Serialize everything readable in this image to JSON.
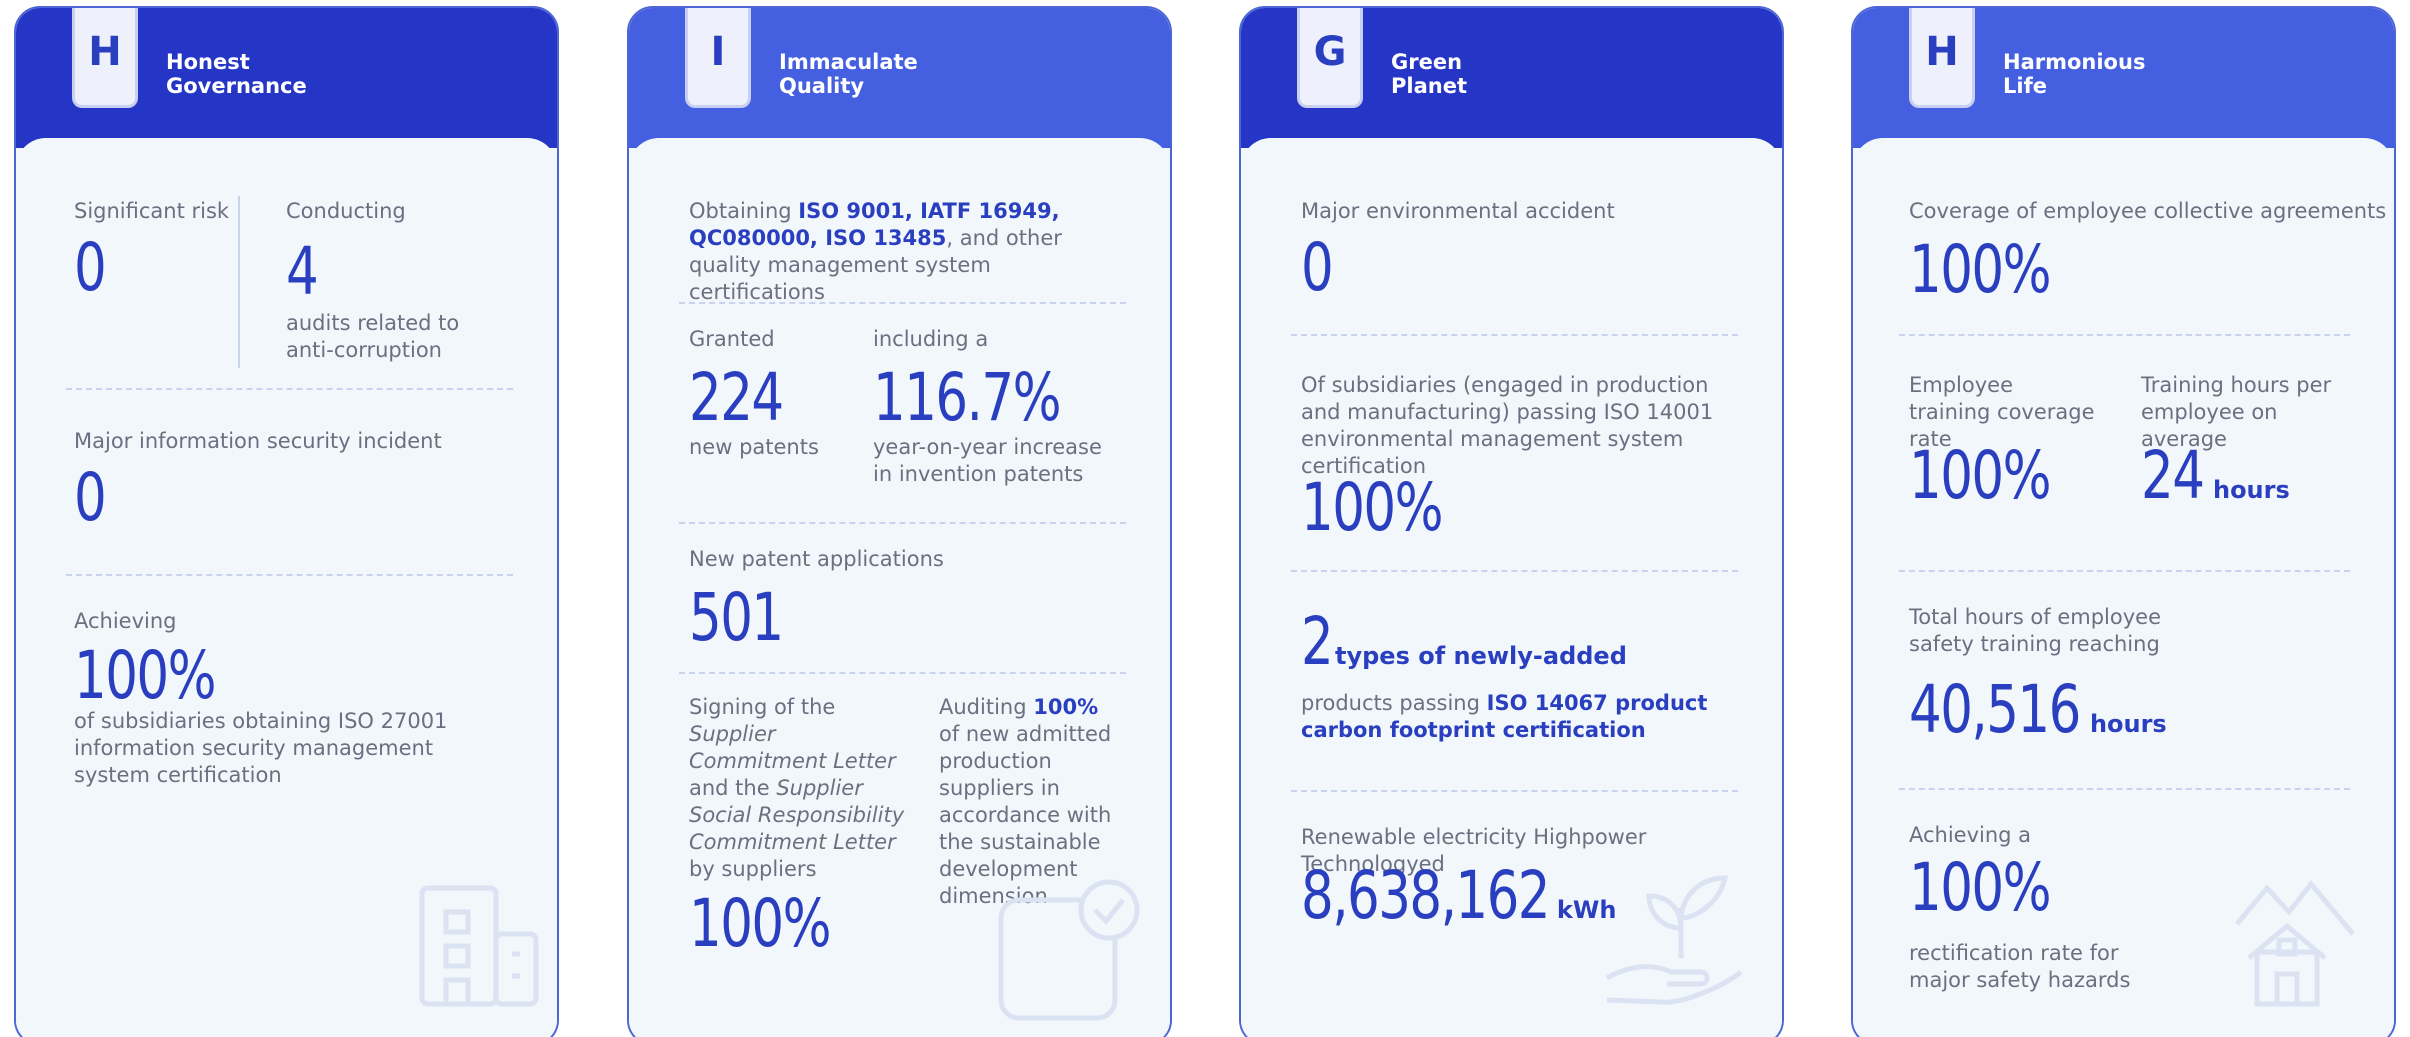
{
  "colors": {
    "accent": "#2a3fbf",
    "header_dark": "#2536c6",
    "header_light": "#4460e0",
    "card_bg": "#f2f7fc"
  },
  "cards": [
    {
      "letter": "H",
      "title_line1": "Honest",
      "title_line2": "Governance",
      "significant_risk_label": "Significant risk",
      "significant_risk_value": "0",
      "conducting_label": "Conducting",
      "conducting_value": "4",
      "conducting_desc": "audits related to anti-corruption",
      "security_label": "Major information security incident",
      "security_value": "0",
      "achieving_label": "Achieving",
      "achieving_value": "100%",
      "achieving_desc": "of subsidiaries obtaining ISO 27001 information security management system certification",
      "icon": "building-icon"
    },
    {
      "letter": "I",
      "title_line1": "Immaculate",
      "title_line2": "Quality",
      "obtaining_prefix": "Obtaining ",
      "obtaining_highlight": "ISO 9001, IATF 16949, QC080000, ISO 13485",
      "obtaining_suffix": ", and other quality management system certifications",
      "granted_label": "Granted",
      "granted_value": "224",
      "granted_desc": "new patents",
      "including_label": "including a",
      "including_value": "116.7%",
      "including_desc": "year-on-year increase in invention patents",
      "applications_label": "New patent applications",
      "applications_value": "501",
      "signing_prefix": "Signing of the ",
      "signing_italic1": "Supplier Commitment Letter",
      "signing_mid": " and the ",
      "signing_italic2": "Supplier Social Responsibility Commitment Letter",
      "signing_suffix": " by suppliers",
      "signing_value": "100%",
      "auditing_prefix": "Auditing ",
      "auditing_highlight": "100%",
      "auditing_desc": "of new admitted production suppliers in accordance with the sustainable development dimension",
      "icon": "checklist-icon"
    },
    {
      "letter": "G",
      "title_line1": "Green",
      "title_line2": "Planet",
      "accident_label": "Major environmental accident",
      "accident_value": "0",
      "subsidiaries_label": "Of subsidiaries (engaged in production and manufacturing) passing ISO 14001 environmental management system certification",
      "subsidiaries_value": "100%",
      "types_value": "2",
      "types_unit": "types of newly-added",
      "types_prefix": "products passing ",
      "types_highlight": "ISO 14067 product carbon footprint certification",
      "renewable_label": "Renewable electricity Highpower Technologyed",
      "renewable_value": "8,638,162",
      "renewable_unit": "kWh",
      "icon": "plant-hand-icon"
    },
    {
      "letter": "H",
      "title_line1": "Harmonious",
      "title_line2": "Life",
      "coverage_label": "Coverage of employee collective agreements",
      "coverage_value": "100%",
      "training_rate_label": "Employee training coverage rate",
      "training_rate_value": "100%",
      "training_hours_label": "Training hours per employee on average",
      "training_hours_value": "24",
      "training_hours_unit": "hours",
      "safety_label": "Total hours of employee safety training reaching",
      "safety_value": "40,516",
      "safety_unit": "hours",
      "rectification_label": "Achieving a",
      "rectification_value": "100%",
      "rectification_desc": "rectification rate for major safety hazards",
      "icon": "house-mountain-icon"
    }
  ]
}
